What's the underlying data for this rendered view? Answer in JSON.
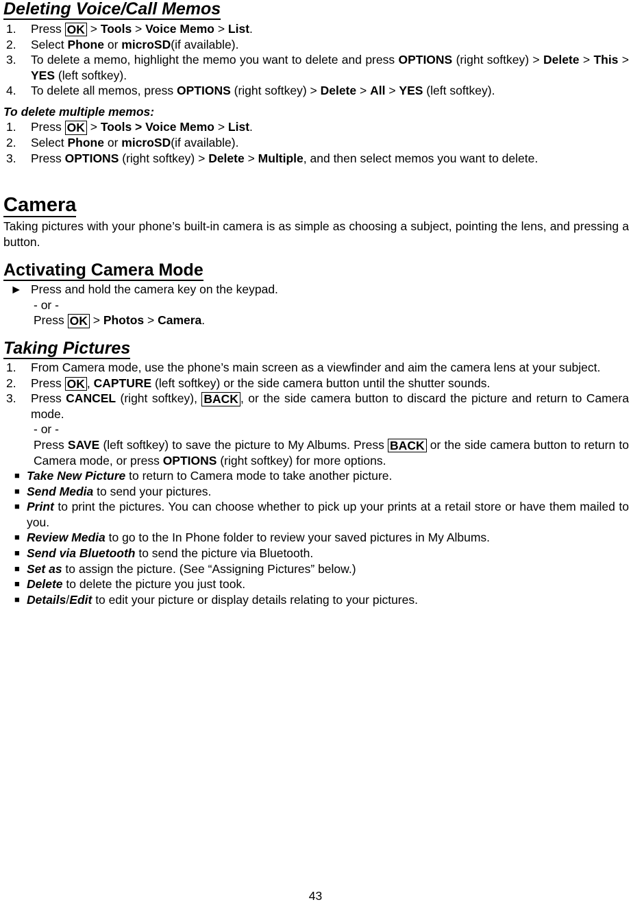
{
  "document": {
    "page_number": "43",
    "sections": [
      {
        "id": "deleting-voice-call-memos",
        "heading": "Deleting Voice/Call Memos",
        "steps": [
          {
            "num": "1.",
            "parts": [
              {
                "t": "Press ",
                "s": "plain"
              },
              {
                "t": "OK",
                "s": "key"
              },
              {
                "t": " > ",
                "s": "plain"
              },
              {
                "t": "Tools",
                "s": "bold"
              },
              {
                "t": " > ",
                "s": "plain"
              },
              {
                "t": "Voice Memo",
                "s": "bold"
              },
              {
                "t": " > ",
                "s": "plain"
              },
              {
                "t": "List",
                "s": "bold"
              },
              {
                "t": ".",
                "s": "plain"
              }
            ]
          },
          {
            "num": "2.",
            "parts": [
              {
                "t": "Select ",
                "s": "plain"
              },
              {
                "t": "Phone",
                "s": "bold"
              },
              {
                "t": " or ",
                "s": "plain"
              },
              {
                "t": "microSD",
                "s": "bold"
              },
              {
                "t": "(if available).",
                "s": "plain"
              }
            ]
          },
          {
            "num": "3.",
            "parts": [
              {
                "t": "To delete a memo, highlight the memo you want to delete and press ",
                "s": "plain"
              },
              {
                "t": "OPTIONS",
                "s": "bold"
              },
              {
                "t": " (right softkey) > ",
                "s": "plain"
              },
              {
                "t": "Delete",
                "s": "bold"
              },
              {
                "t": " > ",
                "s": "plain"
              },
              {
                "t": "This",
                "s": "bold"
              },
              {
                "t": " > ",
                "s": "plain"
              },
              {
                "t": "YES",
                "s": "bold"
              },
              {
                "t": " (left softkey).",
                "s": "plain"
              }
            ]
          },
          {
            "num": "4.",
            "parts": [
              {
                "t": "To delete all memos, press ",
                "s": "plain"
              },
              {
                "t": "OPTIONS",
                "s": "bold"
              },
              {
                "t": " (right softkey) > ",
                "s": "plain"
              },
              {
                "t": "Delete",
                "s": "bold"
              },
              {
                "t": " > ",
                "s": "plain"
              },
              {
                "t": "All",
                "s": "bold"
              },
              {
                "t": " > ",
                "s": "plain"
              },
              {
                "t": "YES",
                "s": "bold"
              },
              {
                "t": " (left softkey).",
                "s": "plain"
              }
            ]
          }
        ]
      },
      {
        "id": "to-delete-multiple-memos",
        "heading": "To delete multiple memos:",
        "steps": [
          {
            "num": "1.",
            "parts": [
              {
                "t": "Press ",
                "s": "plain"
              },
              {
                "t": "OK",
                "s": "key"
              },
              {
                "t": " > ",
                "s": "plain"
              },
              {
                "t": "Tools",
                "s": "bold"
              },
              {
                "t": " > ",
                "s": "bold"
              },
              {
                "t": "Voice Memo",
                "s": "bold"
              },
              {
                "t": " > ",
                "s": "plain"
              },
              {
                "t": "List",
                "s": "bold"
              },
              {
                "t": ".",
                "s": "plain"
              }
            ]
          },
          {
            "num": "2.",
            "parts": [
              {
                "t": "Select ",
                "s": "plain"
              },
              {
                "t": "Phone",
                "s": "bold"
              },
              {
                "t": " or ",
                "s": "plain"
              },
              {
                "t": "microSD",
                "s": "bold"
              },
              {
                "t": "(if available).",
                "s": "plain"
              }
            ]
          },
          {
            "num": "3.",
            "parts": [
              {
                "t": "Press ",
                "s": "plain"
              },
              {
                "t": "OPTIONS",
                "s": "bold"
              },
              {
                "t": " (right softkey) > ",
                "s": "plain"
              },
              {
                "t": "Delete",
                "s": "bold"
              },
              {
                "t": " > ",
                "s": "plain"
              },
              {
                "t": "Multiple",
                "s": "bold"
              },
              {
                "t": ", and then select memos you want to delete.",
                "s": "plain"
              }
            ]
          }
        ]
      }
    ],
    "camera": {
      "heading": "Camera",
      "intro": "Taking pictures with your phone’s built-in camera is as simple as choosing a subject, pointing the lens, and pressing a button.",
      "activating": {
        "heading": "Activating Camera Mode",
        "arrow_marker": "►",
        "arrow_text": "Press and hold the camera key on the keypad.",
        "or_text": "- or -",
        "press_parts": [
          {
            "t": "Press ",
            "s": "plain"
          },
          {
            "t": "OK",
            "s": "key"
          },
          {
            "t": " > ",
            "s": "plain"
          },
          {
            "t": "Photos",
            "s": "bold"
          },
          {
            "t": " > ",
            "s": "plain"
          },
          {
            "t": "Camera",
            "s": "bold"
          },
          {
            "t": ".",
            "s": "plain"
          }
        ]
      },
      "taking_pictures": {
        "heading": "Taking Pictures",
        "steps": [
          {
            "num": "1.",
            "parts": [
              {
                "t": "From Camera mode, use the phone’s main screen as a viewfinder and aim the camera lens at your subject.",
                "s": "plain"
              }
            ]
          },
          {
            "num": "2.",
            "parts": [
              {
                "t": "Press ",
                "s": "plain"
              },
              {
                "t": "OK",
                "s": "key"
              },
              {
                "t": ", ",
                "s": "plain"
              },
              {
                "t": "CAPTURE",
                "s": "bold"
              },
              {
                "t": " (left softkey) or the side camera button until the shutter sounds.",
                "s": "plain"
              }
            ]
          },
          {
            "num": "3.",
            "parts": [
              {
                "t": "Press ",
                "s": "plain"
              },
              {
                "t": "CANCEL",
                "s": "bold"
              },
              {
                "t": " (right softkey), ",
                "s": "plain"
              },
              {
                "t": "BACK",
                "s": "key"
              },
              {
                "t": ", or the side camera button to discard the picture and return to Camera mode.",
                "s": "plain"
              }
            ]
          }
        ],
        "or_text": "- or -",
        "save_parts": [
          {
            "t": "Press ",
            "s": "plain"
          },
          {
            "t": "SAVE",
            "s": "bold"
          },
          {
            "t": " (left softkey) to save the picture to My Albums. Press ",
            "s": "plain"
          },
          {
            "t": "BACK",
            "s": "key"
          },
          {
            "t": " or the side camera button to return to Camera mode, or press ",
            "s": "plain"
          },
          {
            "t": "OPTIONS",
            "s": "bold"
          },
          {
            "t": " (right softkey) for more options.",
            "s": "plain"
          }
        ],
        "bullets": [
          {
            "marker": "■",
            "parts": [
              {
                "t": "Take New Picture",
                "s": "bolditalic"
              },
              {
                "t": " to return to Camera mode to take another picture.",
                "s": "plain"
              }
            ]
          },
          {
            "marker": "■",
            "parts": [
              {
                "t": "Send Media",
                "s": "bolditalic"
              },
              {
                "t": " to send your pictures.",
                "s": "plain"
              }
            ]
          },
          {
            "marker": "■",
            "parts": [
              {
                "t": "Print",
                "s": "bolditalic"
              },
              {
                "t": " to print the pictures. You can choose whether to pick up your prints at a retail store or have them mailed to you.",
                "s": "plain"
              }
            ]
          },
          {
            "marker": "■",
            "parts": [
              {
                "t": "Review Media",
                "s": "bolditalic"
              },
              {
                "t": " to go to the In Phone folder to review your saved pictures in My Albums.",
                "s": "plain"
              }
            ]
          },
          {
            "marker": "■",
            "parts": [
              {
                "t": "Send via Bluetooth",
                "s": "bolditalic"
              },
              {
                "t": " to send the picture via Bluetooth.",
                "s": "plain"
              }
            ]
          },
          {
            "marker": "■",
            "parts": [
              {
                "t": "Set as",
                "s": "bolditalic"
              },
              {
                "t": " to assign the picture. (See “Assigning Pictures” below.)",
                "s": "plain"
              }
            ]
          },
          {
            "marker": "■",
            "parts": [
              {
                "t": "Delete",
                "s": "bolditalic"
              },
              {
                "t": " to delete the picture you just took.",
                "s": "plain"
              }
            ]
          },
          {
            "marker": "■",
            "parts": [
              {
                "t": "Details",
                "s": "bolditalic"
              },
              {
                "t": "/",
                "s": "plain"
              },
              {
                "t": "Edit",
                "s": "bolditalic"
              },
              {
                "t": " to edit your picture or display details relating to your pictures.",
                "s": "plain"
              }
            ]
          }
        ]
      }
    }
  }
}
